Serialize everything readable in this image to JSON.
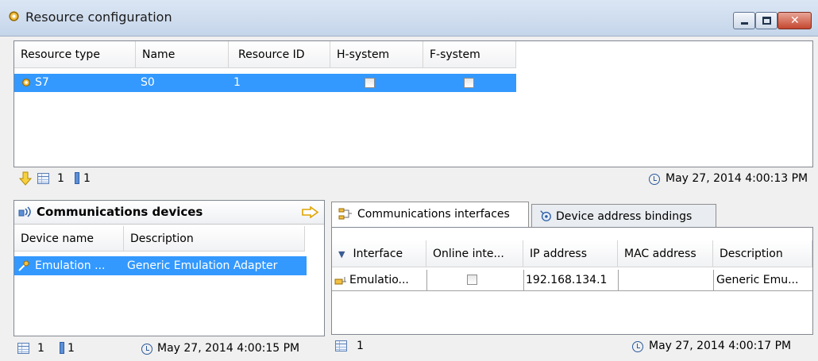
{
  "window": {
    "title": "Resource configuration",
    "controls": {
      "minimize": "minimize",
      "maximize": "maximize",
      "close": "close"
    }
  },
  "resources": {
    "columns": [
      "Resource type",
      "Name",
      "Resource ID",
      "H-system",
      "F-system"
    ],
    "rows": [
      {
        "type": "S7",
        "name": "S0",
        "id": "1",
        "h_system": false,
        "f_system": false
      }
    ],
    "status": {
      "count": "1",
      "bookmarks": "1",
      "timestamp": "May 27, 2014 4:00:13 PM"
    }
  },
  "comm_devices": {
    "title": "Communications devices",
    "columns": [
      "Device name",
      "Description"
    ],
    "rows": [
      {
        "name": "Emulation ...",
        "description": "Generic Emulation Adapter"
      }
    ],
    "status": {
      "count": "1",
      "bookmarks": "1",
      "timestamp": "May 27, 2014 4:00:15 PM"
    }
  },
  "tabs": [
    {
      "label": "Communications interfaces",
      "active": true
    },
    {
      "label": "Device address bindings",
      "active": false
    }
  ],
  "interfaces": {
    "columns": [
      "Interface",
      "Online inte...",
      "IP address",
      "MAC address",
      "Description"
    ],
    "rows": [
      {
        "interface": "Emulatio...",
        "online": false,
        "ip": "192.168.134.1",
        "mac": "",
        "description": "Generic Emu..."
      }
    ],
    "status": {
      "count": "1",
      "timestamp": "May 27, 2014 4:00:17 PM"
    }
  },
  "colors": {
    "selection": "#3399ff",
    "accent_arrow": "#f3b400"
  }
}
